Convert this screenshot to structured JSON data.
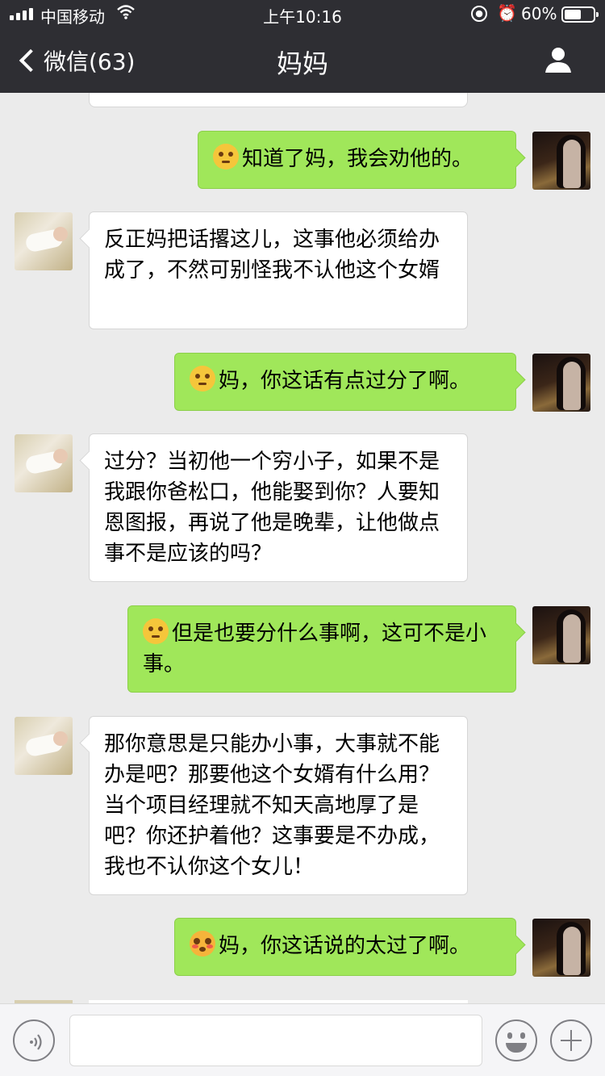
{
  "status_bar": {
    "carrier": "中国移动",
    "time": "上午10:16",
    "battery_text": "60%",
    "battery_level": 0.6,
    "icons": [
      "signal-icon",
      "wifi-icon",
      "rotation-lock-icon",
      "alarm-icon",
      "battery-icon"
    ]
  },
  "nav": {
    "back_label": "微信(63)",
    "title": "妈妈",
    "right_icon": "profile-icon"
  },
  "colors": {
    "nav_bg": "#2e2e33",
    "chat_bg": "#ebebeb",
    "sent_bubble": "#a0e75a",
    "received_bubble": "#ffffff"
  },
  "messages": [
    {
      "from": "me",
      "emoji": "sweat-smile-emoji",
      "text": "知道了妈，我会劝他的。"
    },
    {
      "from": "mom",
      "text": "反正妈把话撂这儿，这事他必须给办成了，不然可别怪我不认他这个女婿"
    },
    {
      "from": "me",
      "emoji": "sweat-smile-emoji",
      "text": "妈，你这话有点过分了啊。"
    },
    {
      "from": "mom",
      "text": "过分？当初他一个穷小子，如果不是我跟你爸松口，他能娶到你？人要知恩图报，再说了他是晚辈，让他做点事不是应该的吗？"
    },
    {
      "from": "me",
      "emoji": "sweat-smile-emoji",
      "text": "但是也要分什么事啊，这可不是小事。"
    },
    {
      "from": "mom",
      "text": "那你意思是只能办小事，大事就不能办是吧？那要他这个女婿有什么用？当个项目经理就不知天高地厚了是吧？你还护着他？这事要是不办成，我也不认你这个女儿！"
    },
    {
      "from": "me",
      "emoji": "flushed-emoji",
      "text": "妈，你这话说的太过了啊。"
    }
  ],
  "input_bar": {
    "placeholder": "",
    "icons": [
      "voice-icon",
      "emoji-icon",
      "plus-icon"
    ]
  }
}
